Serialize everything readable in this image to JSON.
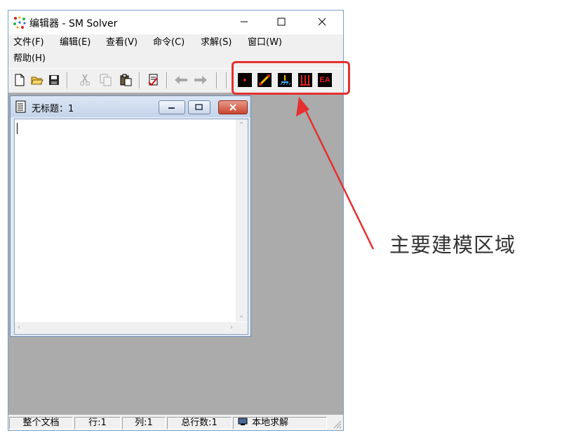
{
  "window": {
    "title": "编辑器 - SM Solver",
    "controls": {
      "minimize": "—",
      "maximize": "☐",
      "close": "✕"
    }
  },
  "menu": {
    "items": [
      "文件(F)",
      "编辑(E)",
      "查看(V)",
      "命令(C)",
      "求解(S)",
      "窗口(W)",
      "帮助(H)"
    ]
  },
  "toolbar": {
    "icons": [
      "new-file-icon",
      "open-folder-icon",
      "save-icon",
      "cut-icon",
      "copy-icon",
      "paste-icon",
      "check-doc-icon",
      "back-arrow-icon",
      "forward-arrow-icon"
    ],
    "modeling_buttons": [
      {
        "name": "point-node-icon",
        "label": ""
      },
      {
        "name": "line-element-icon",
        "label": ""
      },
      {
        "name": "support-icon",
        "label": ""
      },
      {
        "name": "load-icon",
        "label": ""
      },
      {
        "name": "ea-section-icon",
        "label": "EA"
      }
    ],
    "modeling_bg": "#000000",
    "modeling_fg": "#e0201b"
  },
  "child_window": {
    "title": "无标题：1"
  },
  "statusbar": {
    "scope": "整个文档",
    "row": "行:1",
    "col": "列:1",
    "total": "总行数:1",
    "mode": "本地求解"
  },
  "annotation": {
    "label": "主要建模区域",
    "color": "#e53030"
  }
}
